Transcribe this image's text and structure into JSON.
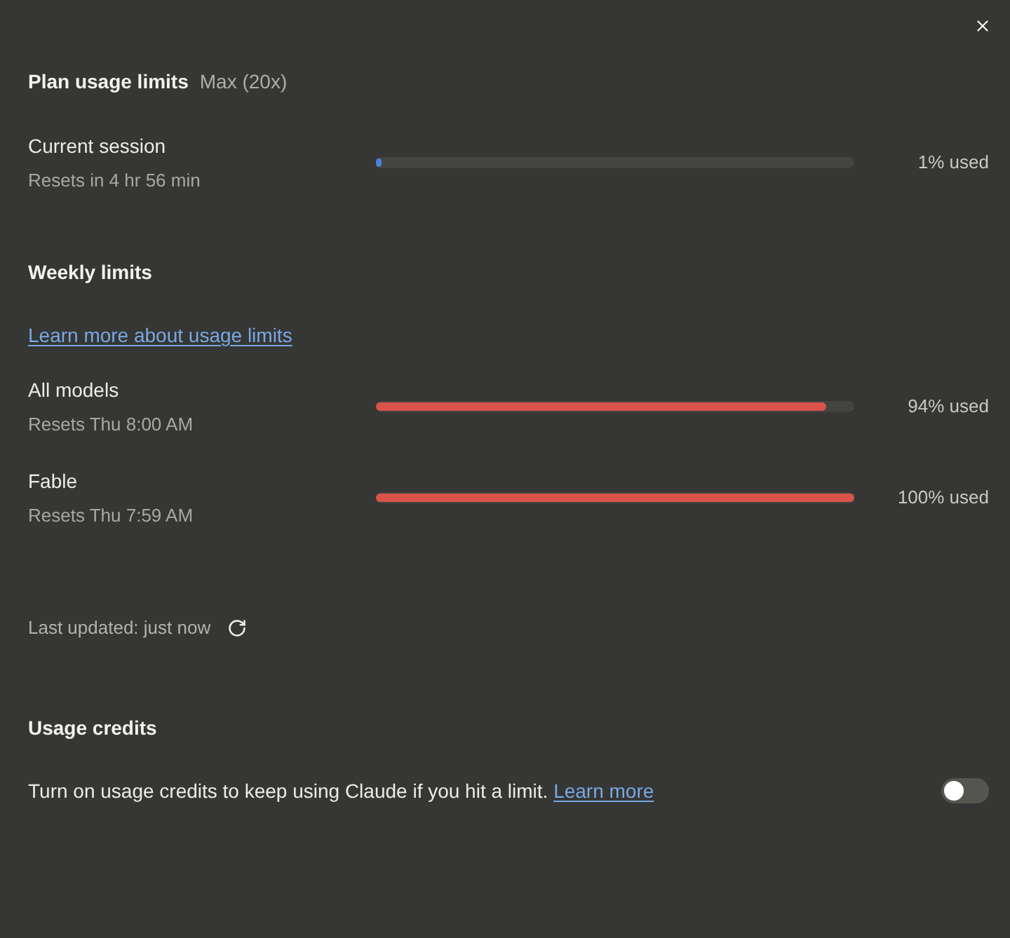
{
  "title": "Plan usage limits",
  "plan": "Max (20x)",
  "session_limits": [
    {
      "name": "Current session",
      "resets": "Resets in 4 hr 56 min",
      "level": 0.01,
      "reading": "1% used",
      "color": "#4a83d4"
    }
  ],
  "weekly": {
    "title": "Weekly limits",
    "link": "Learn more about usage limits",
    "limits": [
      {
        "name": "All models",
        "resets": "Resets Thu 8:00 AM",
        "level": 0.94,
        "reading": "94% used",
        "color": "#d9534a"
      },
      {
        "name": "Fable",
        "resets": "Resets Thu 7:59 AM",
        "level": 1,
        "reading": "100% used",
        "color": "#d9534a"
      }
    ]
  },
  "last_updated": "Last updated: just now",
  "credits": {
    "title": "Usage credits",
    "text": "Turn on usage credits to keep using Claude if you hit a limit.",
    "link": "Learn more",
    "on": false
  }
}
